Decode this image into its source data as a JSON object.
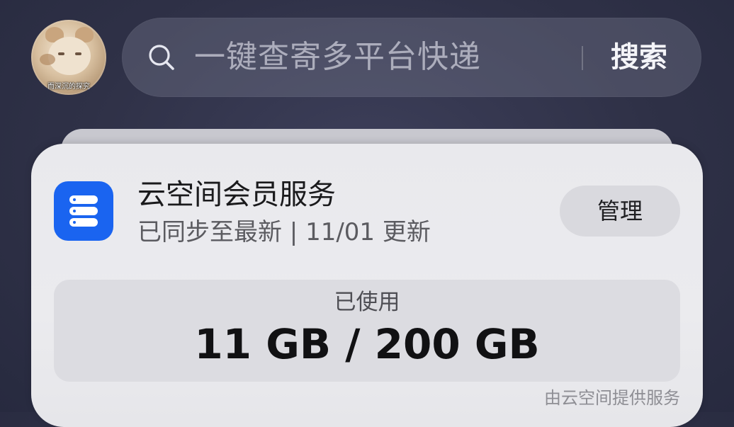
{
  "avatar": {
    "caption": "而深沉的探究"
  },
  "search": {
    "placeholder": "一键查寄多平台快递",
    "button_label": "搜索",
    "icon": "search-icon"
  },
  "widget": {
    "app_icon": "cloud-storage-icon",
    "accent_color": "#1a64f0",
    "title": "云空间会员服务",
    "subtitle": "已同步至最新 | 11/01 更新",
    "manage_label": "管理",
    "usage": {
      "label": "已使用",
      "value": "11 GB / 200 GB",
      "used_gb": 11,
      "total_gb": 200
    },
    "provider_note": "由云空间提供服务"
  }
}
